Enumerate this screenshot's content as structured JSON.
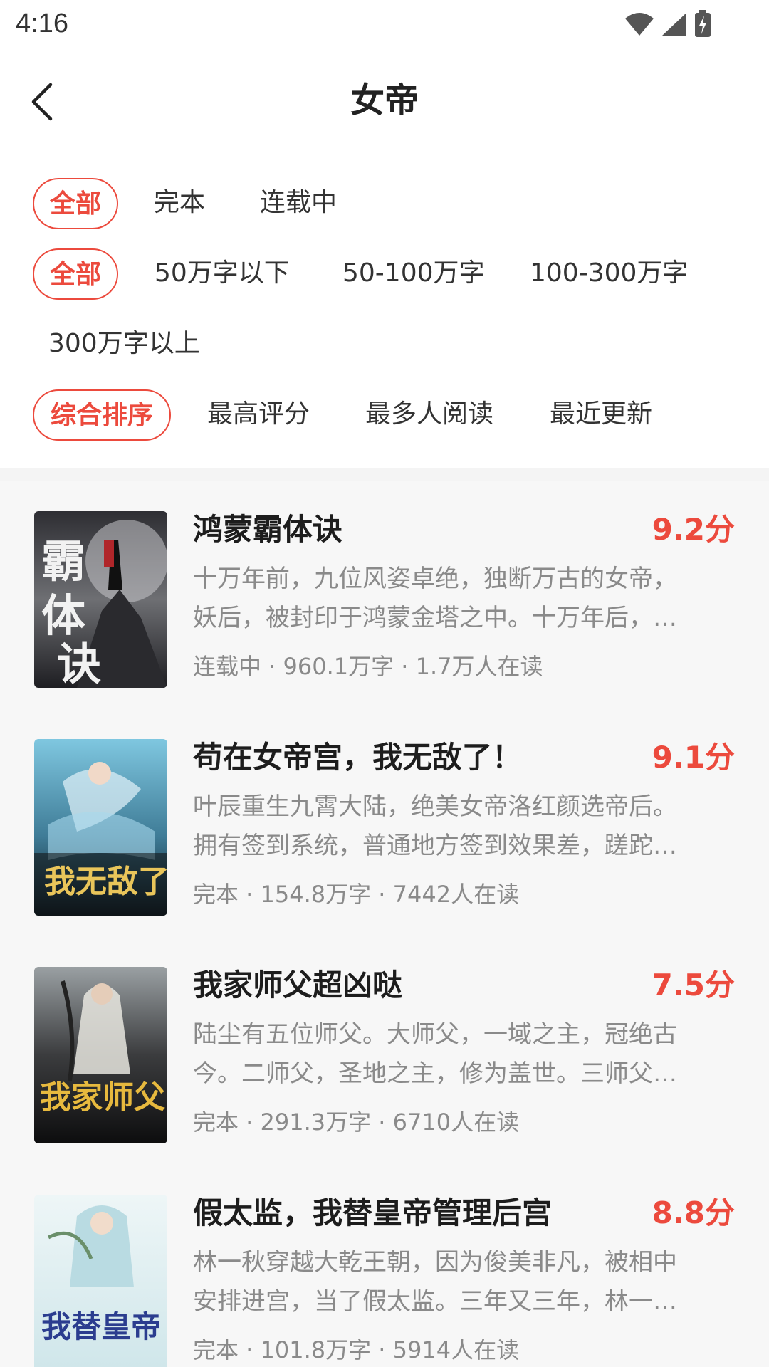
{
  "status_bar": {
    "time": "4:16",
    "icons": [
      "wifi-icon",
      "signal-icon",
      "battery-charging-icon"
    ]
  },
  "header": {
    "title": "女帝",
    "back_icon": "chevron-left-icon"
  },
  "filters": {
    "status": [
      {
        "label": "全部",
        "active": true
      },
      {
        "label": "完本",
        "active": false
      },
      {
        "label": "连载中",
        "active": false
      }
    ],
    "word_count": [
      {
        "label": "全部",
        "active": true
      },
      {
        "label": "50万字以下",
        "active": false
      },
      {
        "label": "50-100万字",
        "active": false
      },
      {
        "label": "100-300万字",
        "active": false
      },
      {
        "label": "300万字以上",
        "active": false
      }
    ],
    "sort": [
      {
        "label": "综合排序",
        "active": true
      },
      {
        "label": "最高评分",
        "active": false
      },
      {
        "label": "最多人阅读",
        "active": false
      },
      {
        "label": "最近更新",
        "active": false
      }
    ]
  },
  "books": [
    {
      "title": "鸿蒙霸体诀",
      "score": "9.2分",
      "desc_line1": "十万年前，九位风姿卓绝，独断万古的女帝，",
      "desc_line2": "妖后，被封印于鸿蒙金塔之中。十万年后，…",
      "meta": "连载中 · 960.1万字 · 1.7万人在读",
      "cover_text": "霸体诀"
    },
    {
      "title": "苟在女帝宫，我无敌了！",
      "score": "9.1分",
      "desc_line1": "叶辰重生九霄大陆，绝美女帝洛红颜选帝后。",
      "desc_line2": "拥有签到系统，普通地方签到效果差，蹉跎…",
      "meta": "完本 · 154.8万字 · 7442人在读",
      "cover_text": "我无敌了"
    },
    {
      "title": "我家师父超凶哒",
      "score": "7.5分",
      "desc_line1": "陆尘有五位师父。大师父，一域之主，冠绝古",
      "desc_line2": "今。二师父，圣地之主，修为盖世。三师父…",
      "meta": "完本 · 291.3万字 · 6710人在读",
      "cover_text": "我家师父"
    },
    {
      "title": "假太监，我替皇帝管理后宫",
      "score": "8.8分",
      "desc_line1": "林一秋穿越大乾王朝，因为俊美非凡，被相中",
      "desc_line2": "安排进宫，当了假太监。三年又三年，林一…",
      "meta": "完本 · 101.8万字 · 5914人在读",
      "cover_text": "我替皇帝"
    }
  ],
  "colors": {
    "accent": "#ec4a3d",
    "text": "#1d1d1d",
    "muted": "#8a8a8a",
    "list_bg": "#f7f7f7"
  }
}
